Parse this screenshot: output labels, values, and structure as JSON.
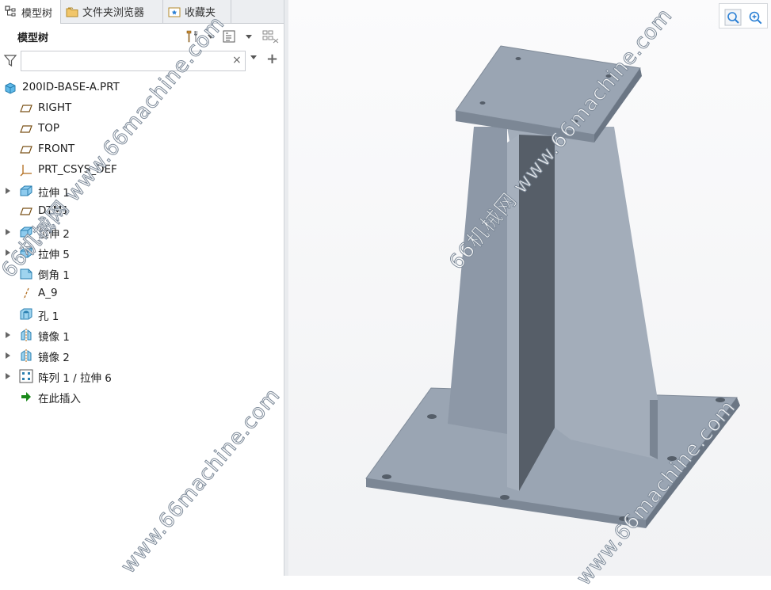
{
  "tabs": [
    {
      "label": "模型树",
      "icon": "model-tree-icon",
      "active": true
    },
    {
      "label": "文件夹浏览器",
      "icon": "folder-browser-icon",
      "active": false
    },
    {
      "label": "收藏夹",
      "icon": "favorites-icon",
      "active": false
    }
  ],
  "panel": {
    "title": "模型树",
    "settings_icon": "tools-icon",
    "show_icon": "tree-columns-icon",
    "filter_icon": "funnel-icon",
    "search_value": "",
    "clear_label": "×",
    "add_label": "+"
  },
  "tree": [
    {
      "label": "200ID-BASE-A.PRT",
      "icon": "part-icon",
      "expandable": false
    },
    {
      "label": "RIGHT",
      "icon": "datum-plane-icon",
      "expandable": false
    },
    {
      "label": "TOP",
      "icon": "datum-plane-icon",
      "expandable": false
    },
    {
      "label": "FRONT",
      "icon": "datum-plane-icon",
      "expandable": false
    },
    {
      "label": "PRT_CSYS_DEF",
      "icon": "csys-icon",
      "expandable": false
    },
    {
      "label": "拉伸 1",
      "icon": "extrude-icon",
      "expandable": true
    },
    {
      "label": "DTM1",
      "icon": "datum-plane-icon",
      "expandable": false
    },
    {
      "label": "拉伸 2",
      "icon": "extrude-icon",
      "expandable": true
    },
    {
      "label": "拉伸 5",
      "icon": "extrude-icon",
      "expandable": true
    },
    {
      "label": "倒角 1",
      "icon": "chamfer-icon",
      "expandable": false
    },
    {
      "label": "A_9",
      "icon": "datum-axis-icon",
      "expandable": false
    },
    {
      "label": "孔 1",
      "icon": "hole-icon",
      "expandable": false
    },
    {
      "label": "镜像 1",
      "icon": "mirror-icon",
      "expandable": true
    },
    {
      "label": "镜像 2",
      "icon": "mirror-icon",
      "expandable": true
    },
    {
      "label": "阵列 1 / 拉伸 6",
      "icon": "pattern-icon",
      "expandable": true
    },
    {
      "label": "在此插入",
      "icon": "insert-here-arrow-icon",
      "expandable": false
    }
  ],
  "viewport": {
    "tools": [
      {
        "icon": "zoom-fit-icon"
      },
      {
        "icon": "zoom-in-icon"
      }
    ],
    "model_color": "#9aa5b3"
  },
  "watermarks": [
    "66机械网 www.66machine.com",
    "www.66machine.com"
  ],
  "colors": {
    "accent": "#2a7fd4",
    "insert_arrow": "#1a8a1a"
  }
}
